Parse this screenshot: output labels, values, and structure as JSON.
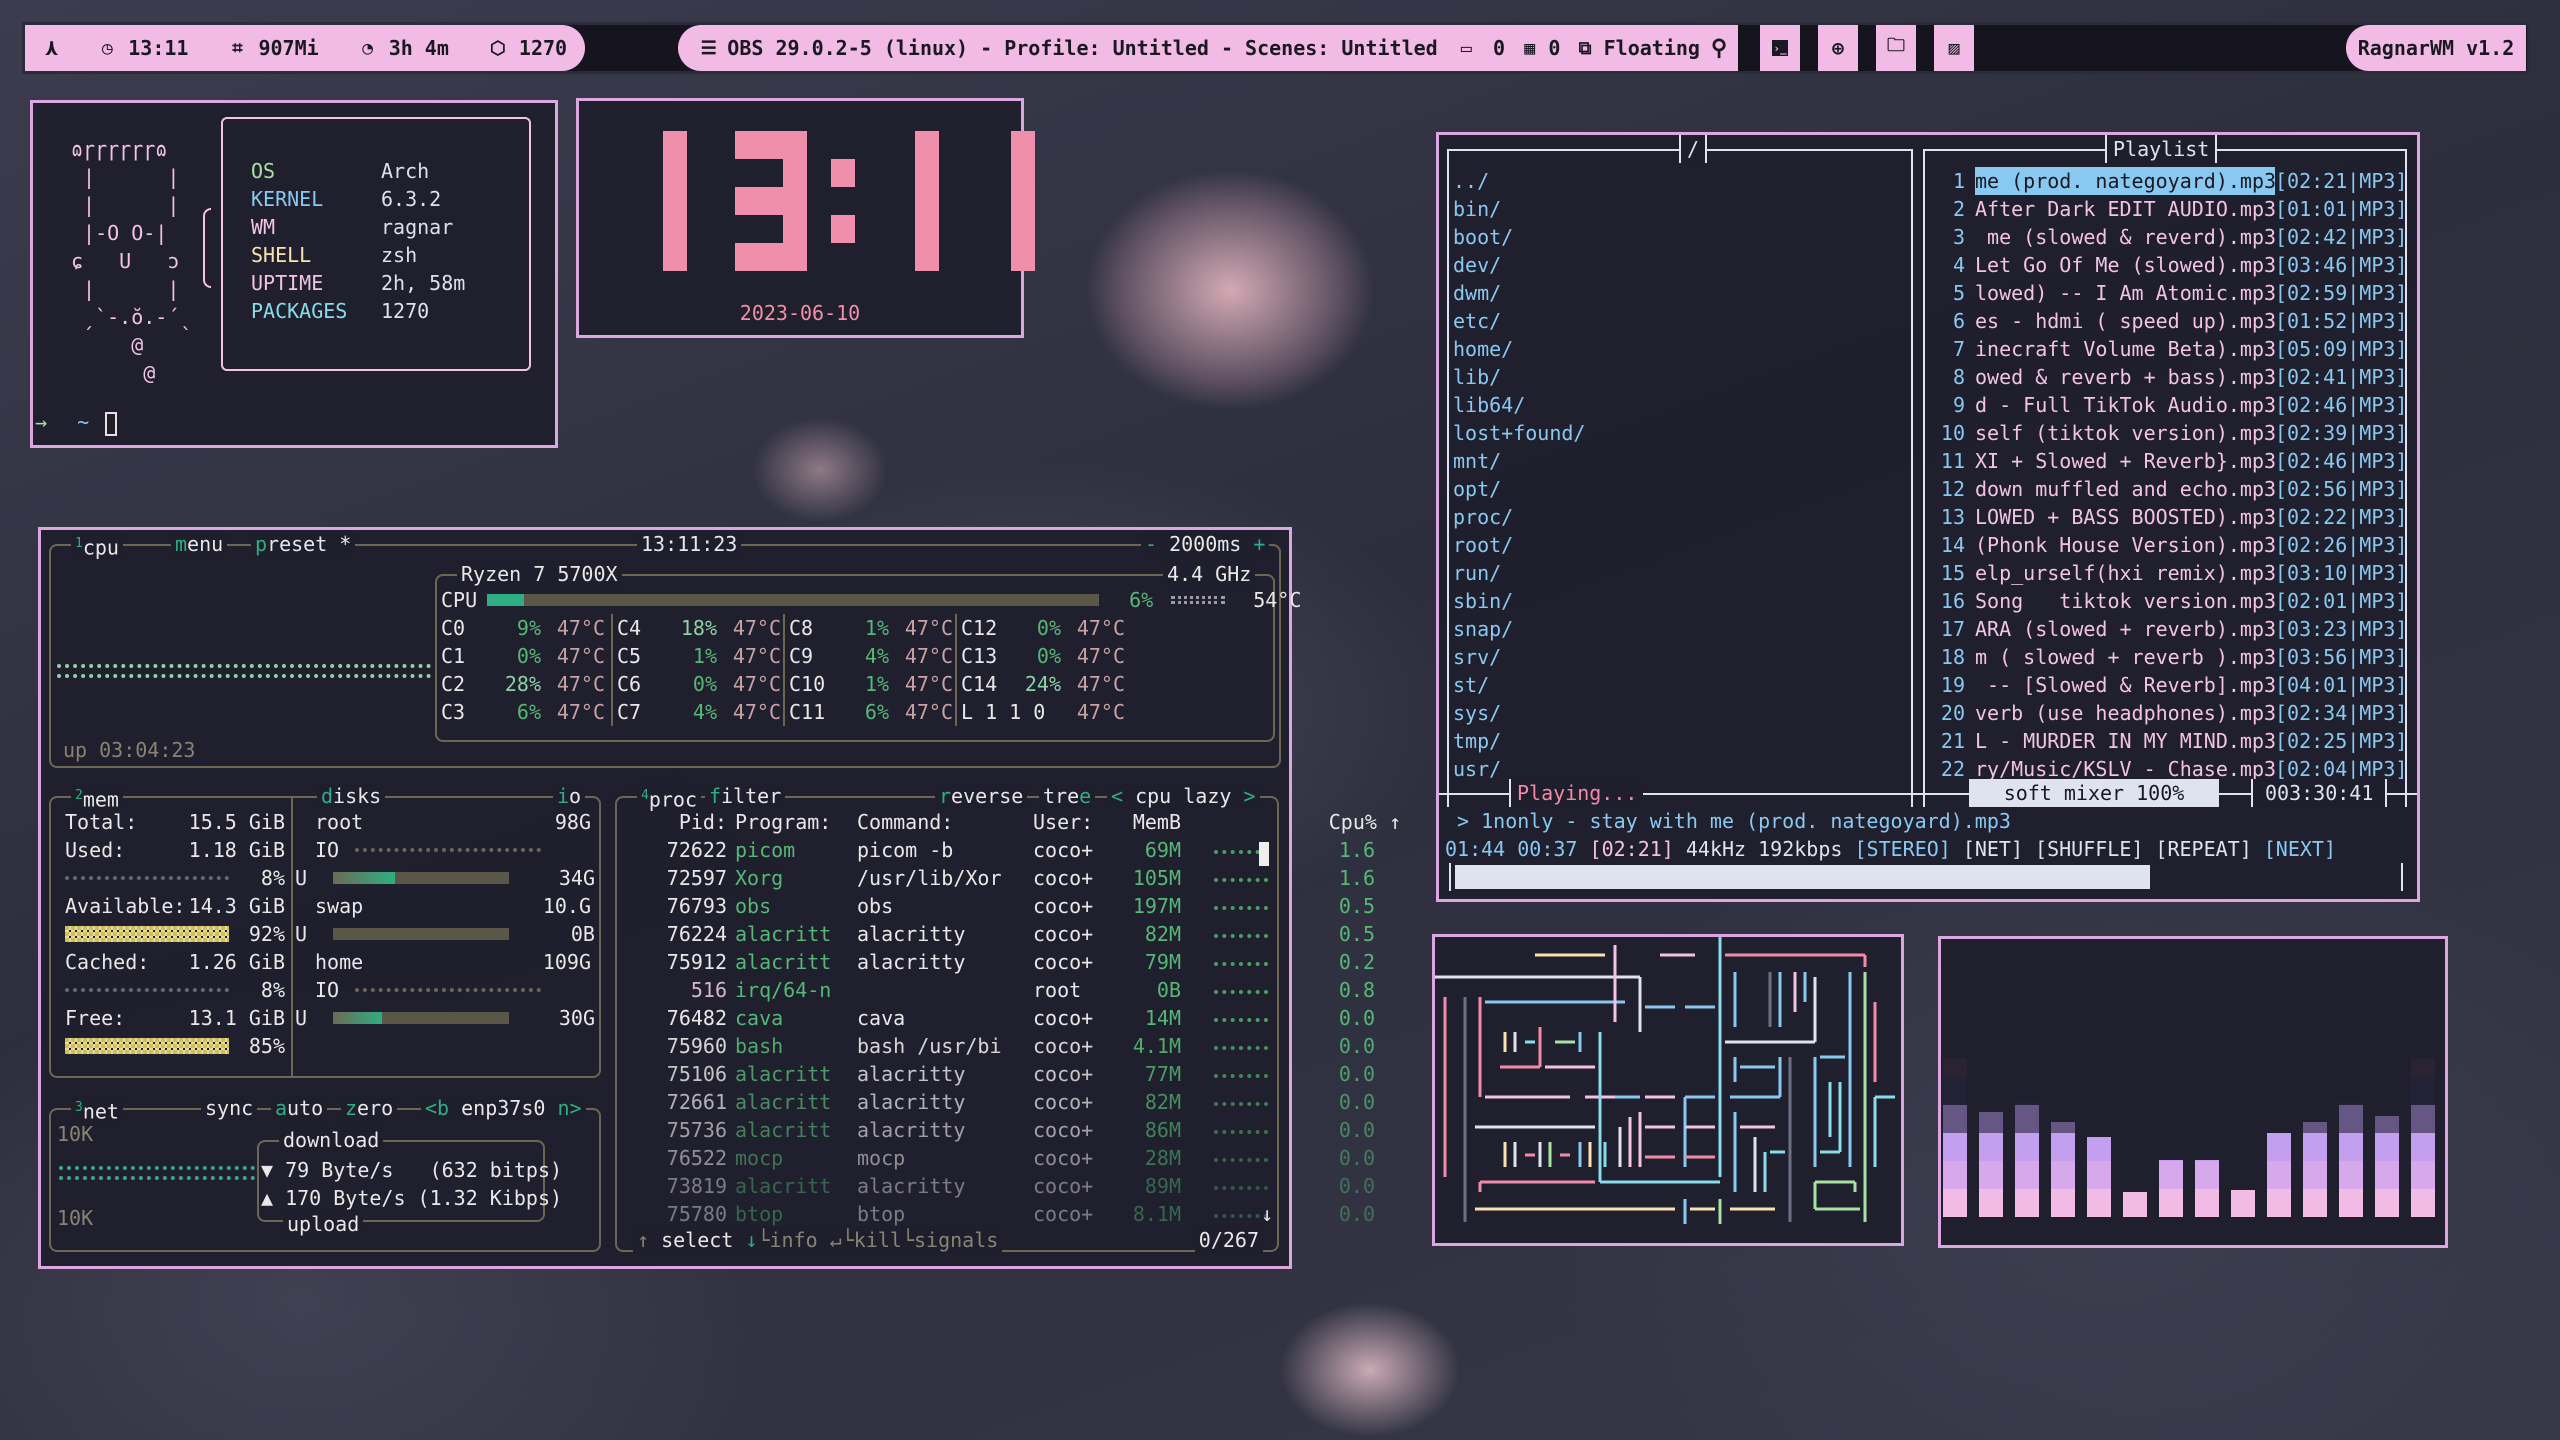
{
  "topbar": {
    "left": {
      "launcher_icon": "arch-logo-icon",
      "time": "13:11",
      "memory": "907Mi",
      "uptime": "3h 4m",
      "packages": "1270"
    },
    "center": {
      "window_title": "OBS 29.0.2-5 (linux) - Profile: Untitled - Scenes: Untitled",
      "monitor_count": "0",
      "workspace_count": "0",
      "layout": "Floating"
    },
    "app_buttons": [
      "search-icon",
      "terminal-icon",
      "globe-icon",
      "files-icon",
      "image-icon"
    ],
    "wm_name": "RagnarWM v1.2"
  },
  "neofetch": {
    "art": [
      "ɷɼɼɼɼɼɼɷ",
      " |      |",
      " |      |",
      " |-O O-|",
      "ɕ   U   ɔ",
      " |      |",
      " ˏ`-.ŏ.-´ˎ",
      "     @",
      "      @"
    ],
    "info": [
      {
        "key": "OS",
        "value": "Arch",
        "color": "#a6e3a1"
      },
      {
        "key": "KERNEL",
        "value": "6.3.2",
        "color": "#89c8f0"
      },
      {
        "key": "WM",
        "value": "ragnar",
        "color": "#f2c3e3"
      },
      {
        "key": "SHELL",
        "value": "zsh",
        "color": "#f9e2af"
      },
      {
        "key": "UPTIME",
        "value": "2h, 58m",
        "color": "#f2c3e3"
      },
      {
        "key": "PACKAGES",
        "value": "1270",
        "color": "#89dceb"
      }
    ],
    "prompt_arrow": "→",
    "prompt_dir": "~"
  },
  "clock": {
    "time": "13:11",
    "date": "2023-06-10"
  },
  "btop": {
    "cpu": {
      "tab_num": "1",
      "tab": "cpu",
      "menu": "menu",
      "preset": "preset *",
      "time": "13:11:23",
      "interval": "2000ms",
      "minus": "-",
      "plus": "+",
      "model": "Ryzen 7 5700X",
      "freq": "4.4 GHz",
      "total_label": "CPU",
      "total_pct": "6%",
      "total_usage": 0.06,
      "temp": "54°C",
      "uptime": "up 03:04:23",
      "cores": [
        [
          {
            "n": "C0",
            "p": "9%",
            "t": "47°C"
          },
          {
            "n": "C4",
            "p": "18%",
            "t": "47°C"
          },
          {
            "n": "C8",
            "p": "1%",
            "t": "47°C"
          },
          {
            "n": "C12",
            "p": "0%",
            "t": "47°C"
          }
        ],
        [
          {
            "n": "C1",
            "p": "0%",
            "t": "47°C"
          },
          {
            "n": "C5",
            "p": "1%",
            "t": "47°C"
          },
          {
            "n": "C9",
            "p": "4%",
            "t": "47°C"
          },
          {
            "n": "C13",
            "p": "0%",
            "t": "47°C"
          }
        ],
        [
          {
            "n": "C2",
            "p": "28%",
            "t": "47°C"
          },
          {
            "n": "C6",
            "p": "0%",
            "t": "47°C"
          },
          {
            "n": "C10",
            "p": "1%",
            "t": "47°C"
          },
          {
            "n": "C14",
            "p": "24%",
            "t": "47°C"
          }
        ],
        [
          {
            "n": "C3",
            "p": "6%",
            "t": "47°C"
          },
          {
            "n": "C7",
            "p": "4%",
            "t": "47°C"
          },
          {
            "n": "C11",
            "p": "6%",
            "t": "47°C"
          },
          {
            "n": "L 1 1 0",
            "p": "",
            "t": "47°C"
          }
        ]
      ]
    },
    "mem": {
      "tab_num": "2",
      "tab": "mem",
      "rows": [
        {
          "label": "Total:",
          "value": "15.5 GiB",
          "pct": ""
        },
        {
          "label": "Used:",
          "value": "1.18 GiB",
          "pct": "8%"
        },
        {
          "label": "Available:",
          "value": "14.3 GiB",
          "pct": "92%"
        },
        {
          "label": "Cached:",
          "value": "1.26 GiB",
          "pct": "8%"
        },
        {
          "label": "Free:",
          "value": "13.1 GiB",
          "pct": "85%"
        }
      ]
    },
    "disks": {
      "tab": "disks",
      "io_tab": "io",
      "items": [
        {
          "name": "root",
          "size": "98G",
          "io": "IO",
          "used_label": "U",
          "used": "34G",
          "usage": 0.35
        },
        {
          "name": "swap",
          "size": "10.G",
          "io": "",
          "used_label": "U",
          "used": "0B",
          "usage": 0
        },
        {
          "name": "home",
          "size": "109G",
          "io": "IO",
          "used_label": "U",
          "used": "30G",
          "usage": 0.28
        }
      ]
    },
    "net": {
      "tab_num": "3",
      "tab": "net",
      "sync": "sync",
      "auto": "auto",
      "zero": "zero",
      "iface_prev": "<b",
      "iface": "enp37s0",
      "iface_next": "n>",
      "scale_top": "10K",
      "scale_bottom": "10K",
      "download_label": "download",
      "upload_label": "upload",
      "down": "▼ 79 Byte/s   (632 bitps)",
      "up": "▲ 170 Byte/s (1.32 Kibps)"
    },
    "proc": {
      "tab_num": "4",
      "tab": "proc",
      "filter": "filter",
      "reverse": "reverse",
      "tree": "tree",
      "sort": "< cpu lazy >",
      "headers": {
        "pid": "Pid:",
        "prog": "Program:",
        "cmd": "Command:",
        "user": "User:",
        "mem": "MemB",
        "cpu": "Cpu% ↑"
      },
      "rows": [
        {
          "pid": "72622",
          "prog": "picom",
          "cmd": "picom -b",
          "user": "coco+",
          "mem": "69M",
          "cpu": "1.6"
        },
        {
          "pid": "72597",
          "prog": "Xorg",
          "cmd": "/usr/lib/Xor",
          "user": "coco+",
          "mem": "105M",
          "cpu": "1.6"
        },
        {
          "pid": "76793",
          "prog": "obs",
          "cmd": "obs",
          "user": "coco+",
          "mem": "197M",
          "cpu": "0.5"
        },
        {
          "pid": "76224",
          "prog": "alacritt",
          "cmd": "alacritty",
          "user": "coco+",
          "mem": "82M",
          "cpu": "0.5"
        },
        {
          "pid": "75912",
          "prog": "alacritt",
          "cmd": "alacritty",
          "user": "coco+",
          "mem": "79M",
          "cpu": "0.2"
        },
        {
          "pid": "516",
          "prog": "irq/64-n",
          "cmd": "",
          "user": "root",
          "mem": "0B",
          "cpu": "0.8"
        },
        {
          "pid": "76482",
          "prog": "cava",
          "cmd": "cava",
          "user": "coco+",
          "mem": "14M",
          "cpu": "0.0"
        },
        {
          "pid": "75960",
          "prog": "bash",
          "cmd": "bash /usr/bi",
          "user": "coco+",
          "mem": "4.1M",
          "cpu": "0.0"
        },
        {
          "pid": "75106",
          "prog": "alacritt",
          "cmd": "alacritty",
          "user": "coco+",
          "mem": "77M",
          "cpu": "0.0"
        },
        {
          "pid": "72661",
          "prog": "alacritt",
          "cmd": "alacritty",
          "user": "coco+",
          "mem": "82M",
          "cpu": "0.0"
        },
        {
          "pid": "75736",
          "prog": "alacritt",
          "cmd": "alacritty",
          "user": "coco+",
          "mem": "86M",
          "cpu": "0.0"
        },
        {
          "pid": "76522",
          "prog": "mocp",
          "cmd": "mocp",
          "user": "coco+",
          "mem": "28M",
          "cpu": "0.0"
        },
        {
          "pid": "73819",
          "prog": "alacritt",
          "cmd": "alacritty",
          "user": "coco+",
          "mem": "89M",
          "cpu": "0.0"
        },
        {
          "pid": "75780",
          "prog": "btop",
          "cmd": "btop",
          "user": "coco+",
          "mem": "8.1M",
          "cpu": "0.0"
        }
      ],
      "footer": {
        "select": "↑ select ↓",
        "info": "info ↵",
        "kill": "kill",
        "signals": "signals",
        "count": "0/267"
      }
    }
  },
  "mocp": {
    "dir_title": "/",
    "dirs": [
      "../",
      "bin/",
      "boot/",
      "dev/",
      "dwm/",
      "etc/",
      "home/",
      "lib/",
      "lib64/",
      "lost+found/",
      "mnt/",
      "opt/",
      "proc/",
      "root/",
      "run/",
      "sbin/",
      "snap/",
      "srv/",
      "st/",
      "sys/",
      "tmp/",
      "usr/"
    ],
    "playlist_title": "Playlist",
    "playlist": [
      {
        "n": "1",
        "name": "me (prod. nategoyard).mp3",
        "info": "[02:21|MP3]"
      },
      {
        "n": "2",
        "name": "After Dark EDIT AUDIO.mp3",
        "info": "[01:01|MP3]"
      },
      {
        "n": "3",
        "name": " me (slowed & reverd).mp3",
        "info": "[02:42|MP3]"
      },
      {
        "n": "4",
        "name": "Let Go Of Me (slowed).mp3",
        "info": "[03:46|MP3]"
      },
      {
        "n": "5",
        "name": "lowed) -- I Am Atomic.mp3",
        "info": "[02:59|MP3]"
      },
      {
        "n": "6",
        "name": "es - hdmi ( speed up).mp3",
        "info": "[01:52|MP3]"
      },
      {
        "n": "7",
        "name": "inecraft Volume Beta).mp3",
        "info": "[05:09|MP3]"
      },
      {
        "n": "8",
        "name": "owed & reverb + bass).mp3",
        "info": "[02:41|MP3]"
      },
      {
        "n": "9",
        "name": "d - Full TikTok Audio.mp3",
        "info": "[02:46|MP3]"
      },
      {
        "n": "10",
        "name": "self (tiktok version).mp3",
        "info": "[02:39|MP3]"
      },
      {
        "n": "11",
        "name": "XI + Slowed + Reverb}.mp3",
        "info": "[02:46|MP3]"
      },
      {
        "n": "12",
        "name": "down muffled and echo.mp3",
        "info": "[02:56|MP3]"
      },
      {
        "n": "13",
        "name": "LOWED + BASS BOOSTED).mp3",
        "info": "[02:22|MP3]"
      },
      {
        "n": "14",
        "name": "(Phonk House Version).mp3",
        "info": "[02:26|MP3]"
      },
      {
        "n": "15",
        "name": "elp_urself(hxi remix).mp3",
        "info": "[03:10|MP3]"
      },
      {
        "n": "16",
        "name": "Song   tiktok version.mp3",
        "info": "[02:01|MP3]"
      },
      {
        "n": "17",
        "name": "ARA (slowed + reverb).mp3",
        "info": "[03:23|MP3]"
      },
      {
        "n": "18",
        "name": "m ( slowed + reverb ).mp3",
        "info": "[03:56|MP3]"
      },
      {
        "n": "19",
        "name": " -- [Slowed & Reverb].mp3",
        "info": "[04:01|MP3]"
      },
      {
        "n": "20",
        "name": "verb (use headphones).mp3",
        "info": "[02:34|MP3]"
      },
      {
        "n": "21",
        "name": "L - MURDER IN MY MIND.mp3",
        "info": "[02:25|MP3]"
      },
      {
        "n": "22",
        "name": "ry/Music/KSLV - Chase.mp3",
        "info": "[02:04|MP3]"
      }
    ],
    "state": "Playing...",
    "mixer": "soft mixer 100%",
    "total_time": "003:30:41",
    "now_playing": " > 1nonly - stay with me (prod. nategoyard).mp3",
    "elapsed": "01:44",
    "remaining": "00:37",
    "duration": "[02:21]",
    "rate": "44kHz",
    "bitrate": "192kbps",
    "flags": [
      "[STEREO]",
      "[NET]",
      "[SHUFFLE]",
      "[REPEAT]",
      "[NEXT]"
    ],
    "progress": 0.74
  },
  "cava": {
    "levels": [
      0.75,
      0.5,
      0.55,
      0.45,
      0.38,
      0.12,
      0.27,
      0.27,
      0.13,
      0.4,
      0.45,
      0.55,
      0.48,
      0.75
    ]
  },
  "colors": {
    "accent_pink": "#f2bbe5",
    "border": "#dca6e0",
    "btop_accent": "#2fae83"
  }
}
